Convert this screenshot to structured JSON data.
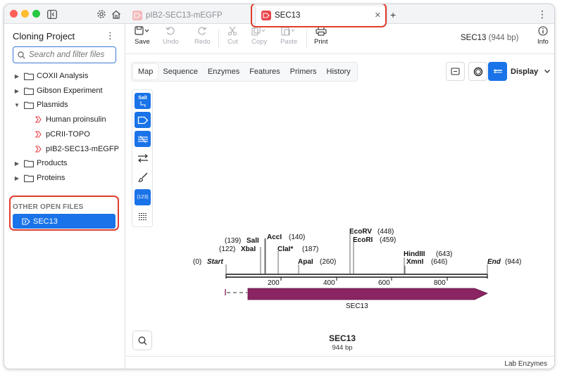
{
  "window": {
    "tabs": [
      {
        "label": "pIB2-SEC13-mEGFP",
        "active": false
      },
      {
        "label": "SEC13",
        "active": true
      }
    ]
  },
  "sidebar": {
    "project_title": "Cloning Project",
    "search_placeholder": "Search and filter files",
    "tree": [
      {
        "label": "COXII Analysis",
        "type": "folder",
        "expanded": false
      },
      {
        "label": "Gibson Experiment",
        "type": "folder",
        "expanded": false
      },
      {
        "label": "Plasmids",
        "type": "folder",
        "expanded": true
      },
      {
        "label": "Human proinsulin",
        "type": "file"
      },
      {
        "label": "pCRII-TOPO",
        "type": "file"
      },
      {
        "label": "pIB2-SEC13-mEGFP",
        "type": "file"
      },
      {
        "label": "Products",
        "type": "folder",
        "expanded": false
      },
      {
        "label": "Proteins",
        "type": "folder",
        "expanded": false
      }
    ],
    "other_open_heading": "OTHER OPEN FILES",
    "open_files": [
      "SEC13"
    ]
  },
  "toolbar": {
    "save": "Save",
    "undo": "Undo",
    "redo": "Redo",
    "cut": "Cut",
    "copy": "Copy",
    "paste": "Paste",
    "print": "Print",
    "info": "Info",
    "seq_name": "SEC13",
    "seq_len": "(944 bp)"
  },
  "view_tabs": [
    "Map",
    "Sequence",
    "Enzymes",
    "Features",
    "Primers",
    "History"
  ],
  "display_label": "Display",
  "left_tools": {
    "enzyme_badge": "SalI",
    "number_badge": "(123)"
  },
  "map": {
    "title": "SEC13",
    "subtitle": "944 bp",
    "start_label": "Start",
    "start_pos": "(0)",
    "end_label": "End",
    "end_pos": "(944)",
    "sites": [
      {
        "name": "SalI",
        "pos": "(139)"
      },
      {
        "name": "XbaI",
        "pos": "(122)"
      },
      {
        "name": "AccI",
        "pos": "(140)"
      },
      {
        "name": "ClaI*",
        "pos": "(187)"
      },
      {
        "name": "ApaI",
        "pos": "(260)"
      },
      {
        "name": "EcoRV",
        "pos": "(448)"
      },
      {
        "name": "EcoRI",
        "pos": "(459)"
      },
      {
        "name": "HindIII",
        "pos": "(643)"
      },
      {
        "name": "XmnI",
        "pos": "(646)"
      }
    ],
    "ticks": [
      "200",
      "400",
      "600",
      "800"
    ],
    "feature": "SEC13",
    "feature_color": "#8b2463"
  },
  "status": "Lab Enzymes",
  "colors": {
    "accent": "#1a73e8",
    "highlight": "#e03e2d"
  }
}
